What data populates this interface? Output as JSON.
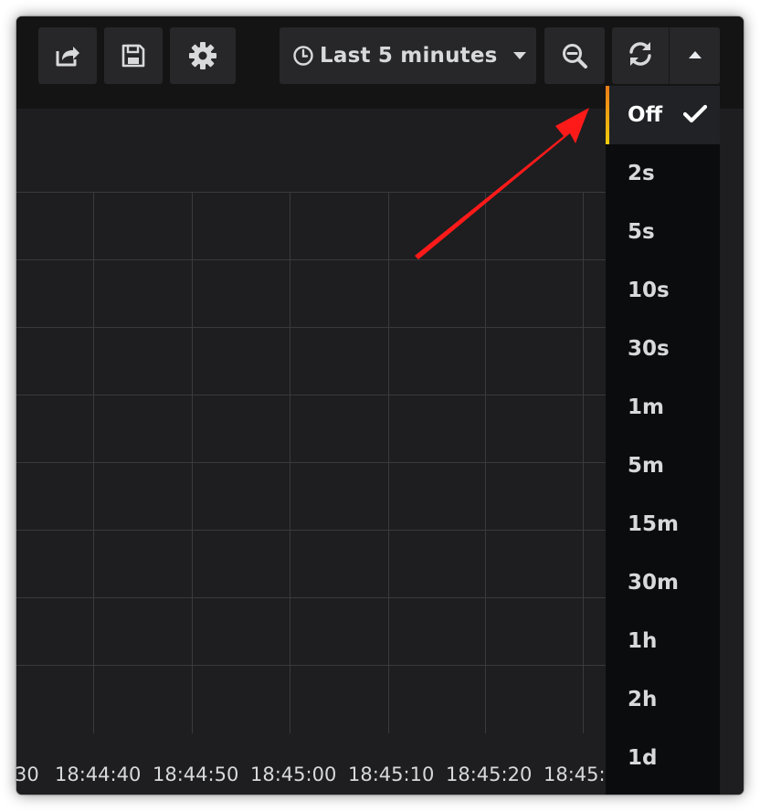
{
  "toolbar": {
    "share_icon": "share-icon",
    "save_icon": "save-icon",
    "settings_icon": "gear-icon",
    "time_range_label": "Last 5 minutes",
    "zoom_icon": "zoom-out-icon",
    "refresh_icon": "refresh-icon",
    "refresh_menu_icon": "caret-up-icon"
  },
  "graph": {
    "x_ticks": [
      "30",
      "18:44:40",
      "18:44:50",
      "18:45:00",
      "18:45:10",
      "18:45:20",
      "18:45:3"
    ]
  },
  "refresh_menu": {
    "selected": "Off",
    "items": [
      {
        "label": "Off"
      },
      {
        "label": "2s"
      },
      {
        "label": "5s"
      },
      {
        "label": "10s"
      },
      {
        "label": "30s"
      },
      {
        "label": "1m"
      },
      {
        "label": "5m"
      },
      {
        "label": "15m"
      },
      {
        "label": "30m"
      },
      {
        "label": "1h"
      },
      {
        "label": "2h"
      },
      {
        "label": "1d"
      }
    ]
  },
  "colors": {
    "background": "#161719",
    "panel": "#1e1e20",
    "button": "#27272a",
    "text": "#d8d9da",
    "accent_orange": "#eb7b18",
    "annotation_arrow": "#ff1a1a"
  }
}
